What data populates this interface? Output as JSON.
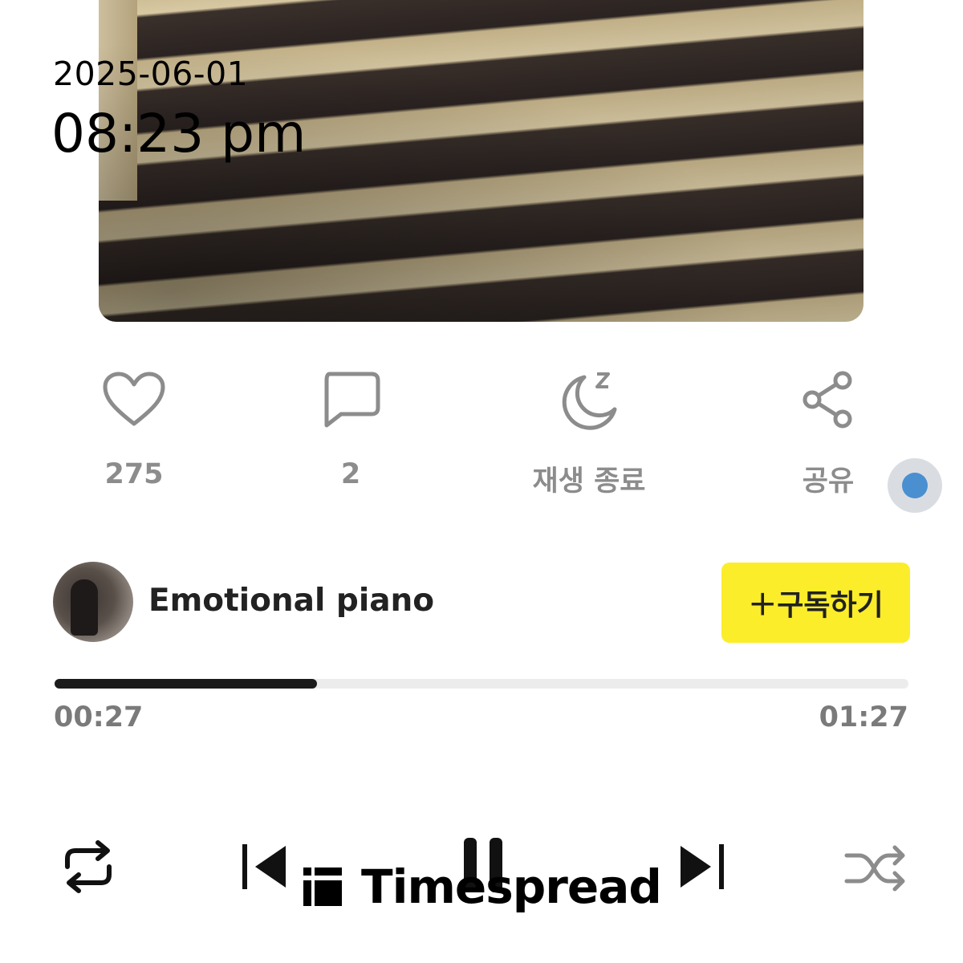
{
  "overlay": {
    "date": "2025-06-01",
    "time": "08:23 pm"
  },
  "actions": {
    "like": {
      "count": "275",
      "icon": "heart-icon"
    },
    "comment": {
      "count": "2",
      "icon": "comment-icon"
    },
    "sleep": {
      "label": "재생 종료",
      "icon": "moon-sleep-icon"
    },
    "share": {
      "label": "공유",
      "icon": "share-icon"
    }
  },
  "channel": {
    "name": "Emotional piano",
    "subscribe_label": "＋구독하기"
  },
  "player": {
    "current_time": "00:27",
    "total_time": "01:27",
    "progress_fraction": 0.307
  },
  "controls": {
    "repeat_icon": "repeat-icon",
    "prev_icon": "skip-previous-icon",
    "pause_icon": "pause-icon",
    "next_icon": "skip-next-icon",
    "shuffle_icon": "shuffle-icon"
  },
  "watermark": {
    "text": "Timespread"
  },
  "colors": {
    "subscribe_bg": "#fced2a",
    "accent_dot": "#4a8fd0",
    "progress_fill": "#1b1b1b",
    "progress_track": "#ececec",
    "muted_text": "#8c8c8c"
  }
}
